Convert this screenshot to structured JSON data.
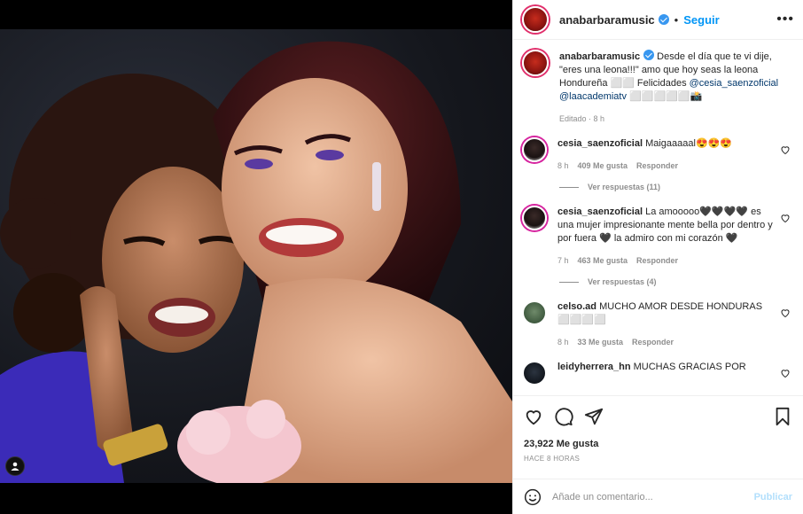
{
  "post": {
    "username": "anabarbaramusic",
    "follow_label": "Seguir",
    "more_label": "•••",
    "separator": "•",
    "caption_text": "Desde el día que te vi dije, \"eres una leona!!!\" amo que hoy seas la leona Hondureña ⬜⬜ Felicidades",
    "caption_mention1": "@cesia_saenzoficial",
    "caption_mention2": "@laacademiatv",
    "caption_tail": "⬜⬜⬜⬜⬜📸",
    "edited": "Editado · 8 h"
  },
  "comments": [
    {
      "username": "cesia_saenzoficial",
      "text": "Maigaaaaal😍😍😍",
      "time": "8 h",
      "likes": "409 Me gusta",
      "reply": "Responder",
      "replies": "Ver respuestas (11)"
    },
    {
      "username": "cesia_saenzoficial",
      "text": "La amooooo🖤🖤🖤🖤 es una mujer impresionante mente bella por dentro y por fuera 🖤 la admiro con mi corazón 🖤",
      "time": "7 h",
      "likes": "463 Me gusta",
      "reply": "Responder",
      "replies": "Ver respuestas (4)"
    },
    {
      "username": "celso.ad",
      "text": "MUCHO AMOR DESDE HONDURAS ⬜⬜⬜⬜",
      "time": "8 h",
      "likes": "33 Me gusta",
      "reply": "Responder"
    },
    {
      "username": "leidyherrera_hn",
      "text": "MUCHAS GRACIAS POR"
    }
  ],
  "footer": {
    "likes": "23,922 Me gusta",
    "ago": "HACE 8 HORAS",
    "comment_placeholder": "Añade un comentario...",
    "publish_label": "Publicar"
  },
  "icons": {
    "like": "heart-icon",
    "comment": "comment-icon",
    "share": "share-icon",
    "save": "bookmark-icon",
    "emoji": "smiley-icon",
    "tag": "user-tag-icon"
  },
  "colors": {
    "accent": "#0095f6",
    "verified": "#3897f0",
    "muted": "#8e8e8e",
    "publish_disabled": "#b2dffc"
  }
}
